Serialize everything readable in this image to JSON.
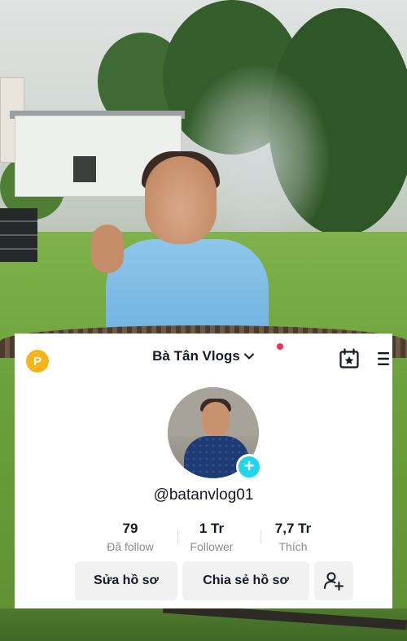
{
  "profile": {
    "username": "Bà Tân Vlogs",
    "handle": "@batanvlog01",
    "points_badge": "P",
    "add_badge": "+",
    "stats": [
      {
        "value": "79",
        "label": "Đã follow"
      },
      {
        "value": "1 Tr",
        "label": "Follower"
      },
      {
        "value": "7,7 Tr",
        "label": "Thích"
      }
    ],
    "buttons": {
      "edit_profile": "Sửa hồ sơ",
      "share_profile": "Chia sẻ hồ sơ"
    }
  },
  "icons": {
    "points": "points-badge-icon",
    "dropdown": "chevron-down-icon",
    "calendar": "calendar-star-icon",
    "menu": "menu-icon",
    "add_friend": "add-friend-icon"
  },
  "colors": {
    "accent_cyan": "#20d5ec",
    "notification_red": "#fe2c55",
    "points_gold": "#f4b41a",
    "text_primary": "#161823",
    "text_secondary": "#8a8b91",
    "button_bg": "#f1f1f2"
  }
}
